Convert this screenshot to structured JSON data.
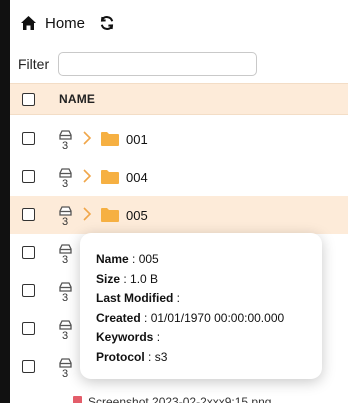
{
  "toolbar": {
    "home_label": "Home",
    "home_icon": "home-icon",
    "refresh_icon": "refresh-icon"
  },
  "filter": {
    "label": "Filter",
    "value": "",
    "placeholder": ""
  },
  "table": {
    "header": {
      "name_label": "NAME"
    },
    "rows": [
      {
        "name": "001",
        "drive_count": "3"
      },
      {
        "name": "004",
        "drive_count": "3"
      },
      {
        "name": "005",
        "drive_count": "3"
      },
      {
        "name": "",
        "drive_count": "3"
      },
      {
        "name": "",
        "drive_count": "3"
      },
      {
        "name": "",
        "drive_count": "3"
      },
      {
        "name": "",
        "drive_count": "3"
      }
    ],
    "partial_row_text": "Screenshot 2023-02-2xxx9:15.png"
  },
  "tooltip": {
    "name_key": "Name",
    "name_value": "005",
    "size_key": "Size",
    "size_value": "1.0 B",
    "modified_key": "Last Modified",
    "modified_value": "",
    "created_key": "Created",
    "created_value": "01/01/1970 00:00:00.000",
    "keywords_key": "Keywords",
    "keywords_value": "",
    "protocol_key": "Protocol",
    "protocol_value": "s3",
    "separator": " : "
  },
  "colors": {
    "folder": "#f6b042",
    "chevron": "#f0a64a",
    "highlight": "#fdebd9",
    "left_strip": "#111111"
  }
}
